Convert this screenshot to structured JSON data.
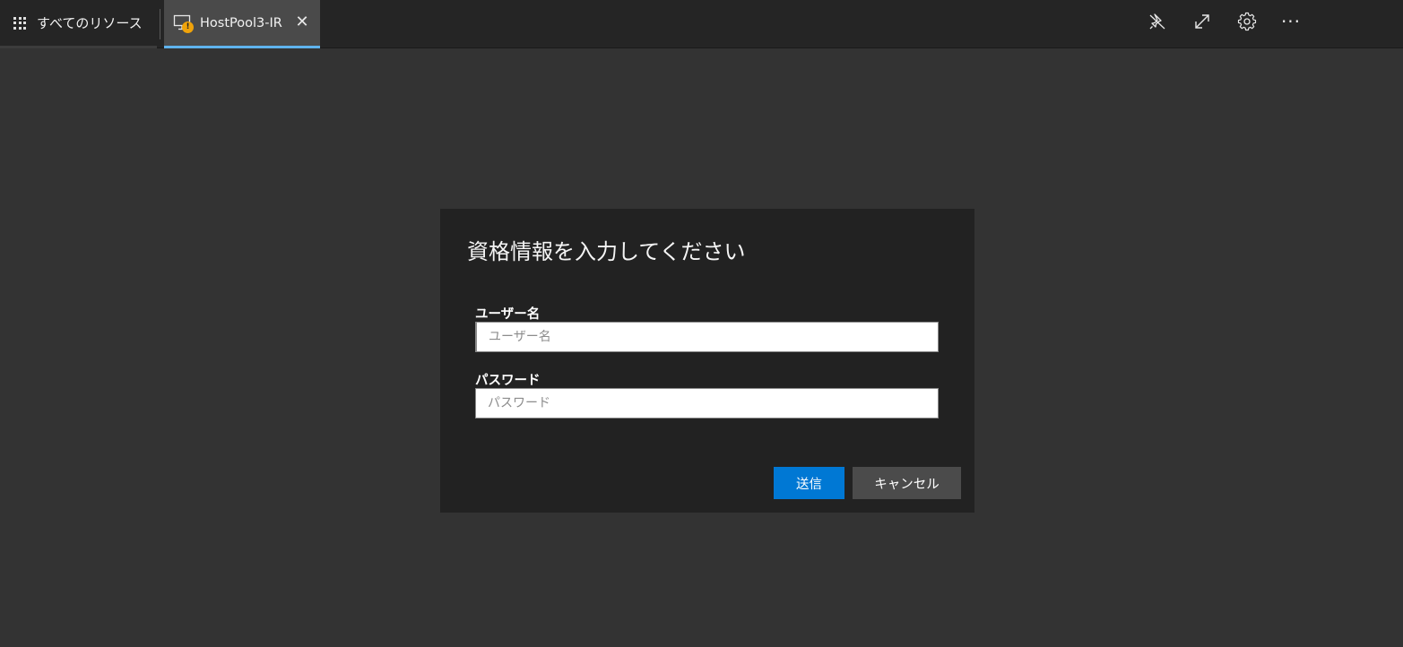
{
  "tabs": {
    "all_resources": {
      "label": "すべてのリソース",
      "icon": "apps-grid-icon"
    },
    "host_pool": {
      "label": "HostPool3-IR",
      "icon": "monitor-warning-icon",
      "badge": "!",
      "close": "✕"
    }
  },
  "toolbar": {
    "icons": [
      "unpin-icon",
      "expand-icon",
      "gear-icon",
      "more-icon"
    ],
    "more_label": "···"
  },
  "dialog": {
    "title": "資格情報を入力してください",
    "username": {
      "label": "ユーザー名",
      "placeholder": "ユーザー名",
      "value": ""
    },
    "password": {
      "label": "パスワード",
      "placeholder": "パスワード",
      "value": ""
    },
    "submit_label": "送信",
    "cancel_label": "キャンセル"
  },
  "colors": {
    "background": "#333333",
    "topbar": "#252525",
    "active_tab": "#4a4a4a",
    "active_tab_underline": "#5fb3ee",
    "dialog": "#222222",
    "primary_button": "#0078d4",
    "secondary_button": "#4b4b4b",
    "warning_badge": "#f0a30a"
  }
}
